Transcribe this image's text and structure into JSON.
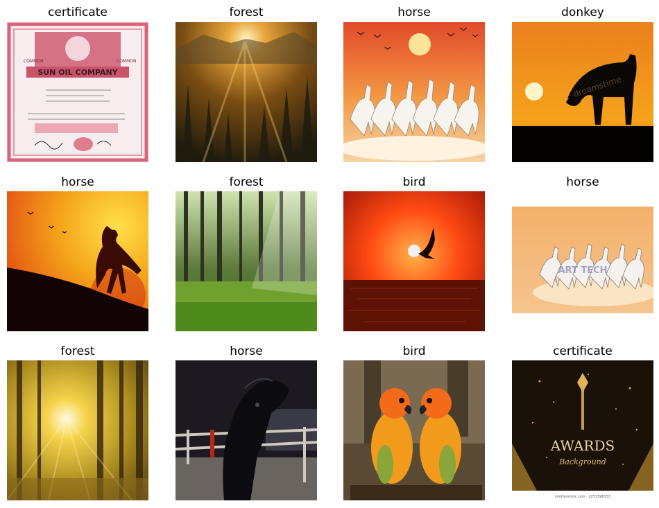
{
  "grid": {
    "labels": [
      "certificate",
      "forest",
      "horse",
      "donkey",
      "horse",
      "forest",
      "bird",
      "horse",
      "forest",
      "horse",
      "bird",
      "certificate"
    ],
    "image_text": {
      "certificate_company": "SUN OIL COMPANY",
      "certificate_common_left": "COMMON",
      "certificate_common_right": "COMMON",
      "donkey_watermark": "dreamstime",
      "horse2_watermark": "ART TECH",
      "awards_title": "AWARDS",
      "awards_subtitle": "Background",
      "awards_credit": "shutterstock.com · 2251596153"
    }
  }
}
